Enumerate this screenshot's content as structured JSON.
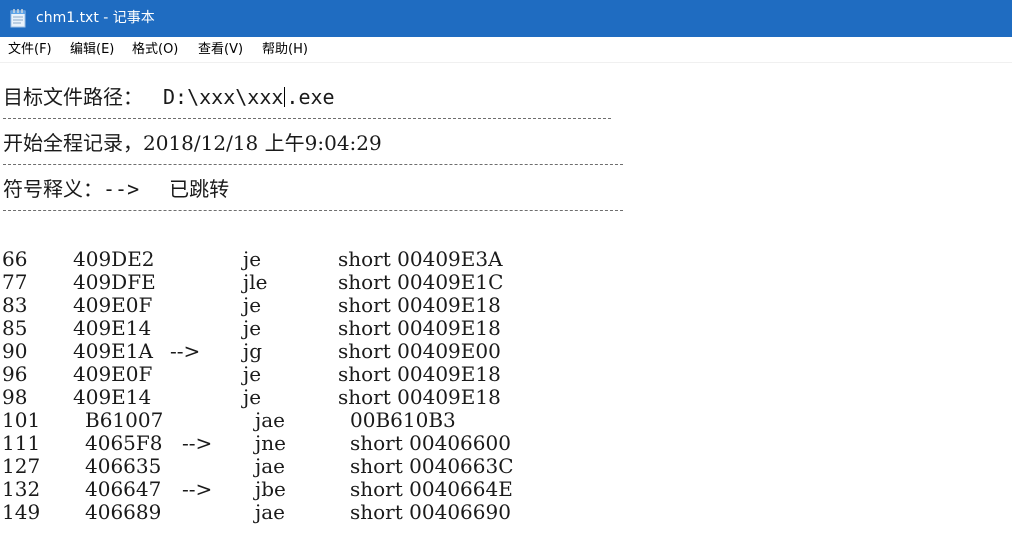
{
  "window": {
    "title": "chm1.txt - 记事本",
    "icon": "notepad-icon"
  },
  "menu": [
    {
      "label": "文件(F)"
    },
    {
      "label": "编辑(E)"
    },
    {
      "label": "格式(O)"
    },
    {
      "label": "查看(V)"
    },
    {
      "label": "帮助(H)"
    }
  ],
  "content": {
    "path_label": "目标文件路径：",
    "path_value_before_caret": "D:\\xxx\\xxx",
    "path_value_after_caret": ".exe",
    "separator_short": "------------------------------------------------",
    "separator": "--------------------------------------------------",
    "record_line": "开始全程记录，2018/12/18 上午9:04:29",
    "legend_label": "符号释义：",
    "legend_arrow": "-->",
    "legend_text": "已跳转"
  },
  "rows": [
    {
      "num": "66",
      "addr": "409DE2",
      "arrow": "",
      "op": "je",
      "operand": "short 00409E3A"
    },
    {
      "num": "77",
      "addr": "409DFE",
      "arrow": "",
      "op": "jle",
      "operand": "short 00409E1C"
    },
    {
      "num": "83",
      "addr": "409E0F",
      "arrow": "",
      "op": "je",
      "operand": "short 00409E18"
    },
    {
      "num": "85",
      "addr": "409E14",
      "arrow": "",
      "op": "je",
      "operand": "short 00409E18"
    },
    {
      "num": "90",
      "addr": "409E1A",
      "arrow": "-->",
      "op": "jg",
      "operand": "short 00409E00"
    },
    {
      "num": "96",
      "addr": "409E0F",
      "arrow": "",
      "op": "je",
      "operand": "short 00409E18"
    },
    {
      "num": "98",
      "addr": "409E14",
      "arrow": "",
      "op": "je",
      "operand": "short 00409E18"
    },
    {
      "num": "101",
      "addr": "B61007",
      "arrow": "",
      "op": "jae",
      "operand": "00B610B3"
    },
    {
      "num": "111",
      "addr": "4065F8",
      "arrow": "-->",
      "op": "jne",
      "operand": "short 00406600"
    },
    {
      "num": "127",
      "addr": "406635",
      "arrow": "",
      "op": "jae",
      "operand": "short 0040663C"
    },
    {
      "num": "132",
      "addr": "406647",
      "arrow": "-->",
      "op": "jbe",
      "operand": "short 0040664E"
    },
    {
      "num": "149",
      "addr": "406689",
      "arrow": "",
      "op": "jae",
      "operand": "short 00406690"
    }
  ],
  "colors": {
    "titlebar": "#1f6cc1",
    "text": "#1a1a1a",
    "background": "#ffffff"
  }
}
